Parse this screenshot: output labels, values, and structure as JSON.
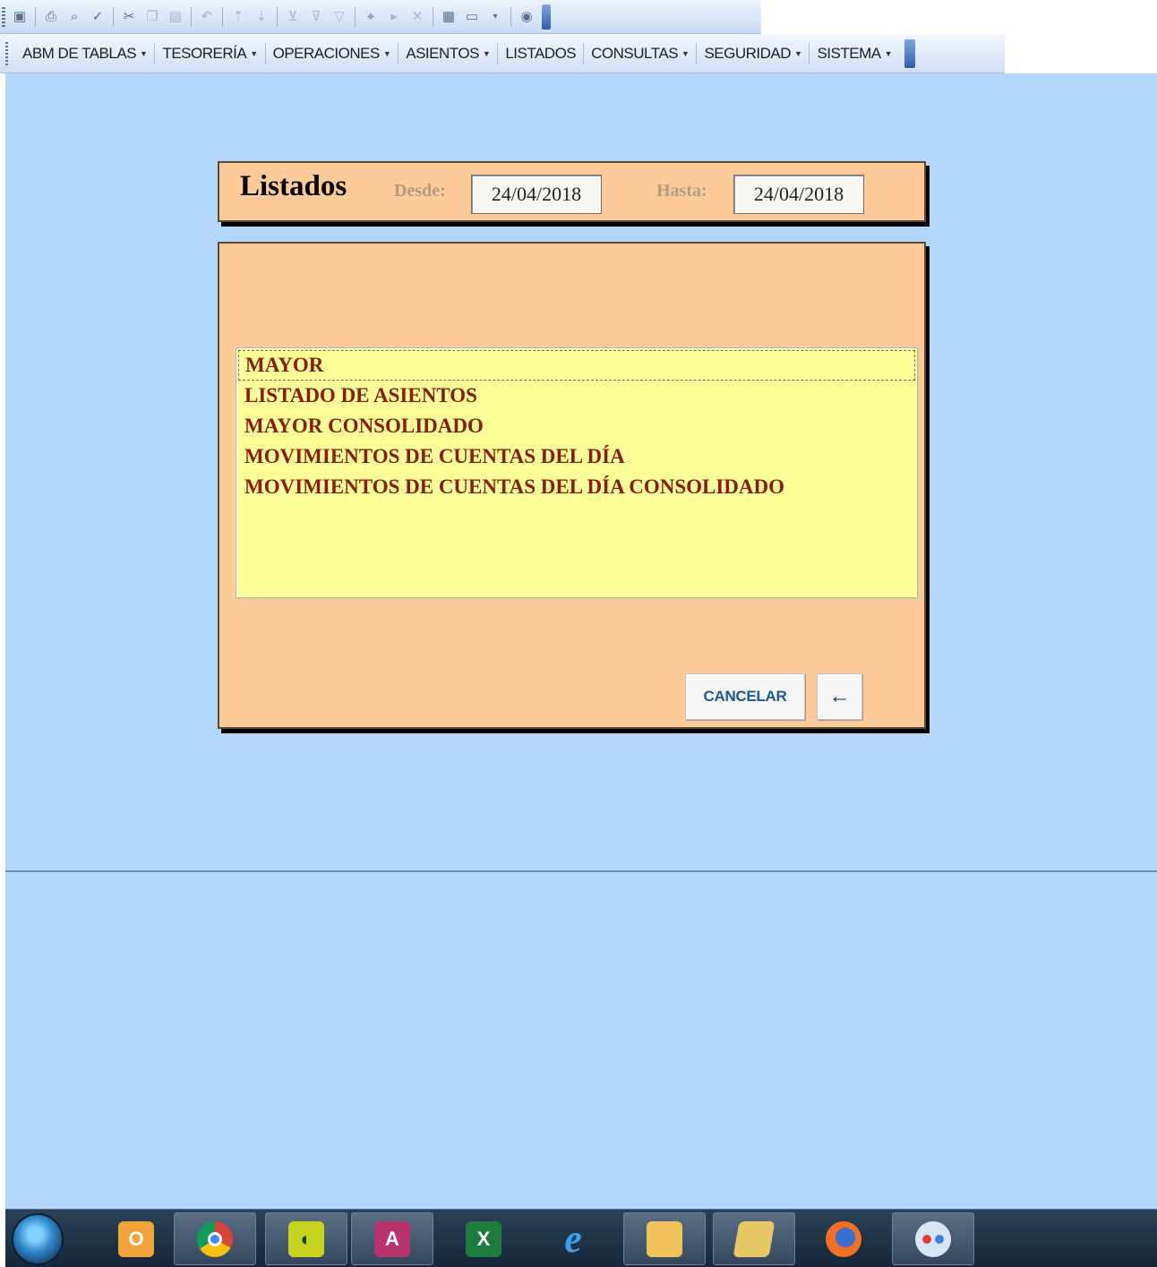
{
  "toolbar": {
    "icons": [
      "save-icon",
      "print-icon",
      "print-preview-icon",
      "spellcheck-icon",
      "cut-icon",
      "copy-icon",
      "paste-icon",
      "undo-icon",
      "sort-ascending-icon",
      "sort-descending-icon",
      "filter-selection-icon",
      "filter-form-icon",
      "apply-filter-icon",
      "find-icon",
      "new-record-icon",
      "delete-record-icon",
      "database-window-icon",
      "new-object-icon",
      "help-icon"
    ]
  },
  "menubar": {
    "items": [
      {
        "label": "ABM DE TABLAS",
        "has_dropdown": true
      },
      {
        "label": "TESORERÍA",
        "has_dropdown": true
      },
      {
        "label": "OPERACIONES",
        "has_dropdown": true
      },
      {
        "label": "ASIENTOS",
        "has_dropdown": true
      },
      {
        "label": "LISTADOS",
        "has_dropdown": false
      },
      {
        "label": "CONSULTAS",
        "has_dropdown": true
      },
      {
        "label": "SEGURIDAD",
        "has_dropdown": true
      },
      {
        "label": "SISTEMA",
        "has_dropdown": true
      }
    ]
  },
  "form": {
    "title": "Listados",
    "desde_label": "Desde:",
    "desde_value": "24/04/2018",
    "hasta_label": "Hasta:",
    "hasta_value": "24/04/2018",
    "list_items": [
      "MAYOR",
      "LISTADO DE ASIENTOS",
      "MAYOR CONSOLIDADO",
      "MOVIMIENTOS DE CUENTAS DEL DÍA",
      "MOVIMIENTOS DE CUENTAS DEL DÍA CONSOLIDADO"
    ],
    "selected_index": 0,
    "cancel_label": "CANCELAR",
    "back_glyph": "←"
  },
  "taskbar": {
    "apps": [
      "windows-start-icon",
      "outlook-icon",
      "chrome-icon",
      "custom-app-icon",
      "access-icon",
      "excel-icon",
      "internet-explorer-icon",
      "file-explorer-icon",
      "folder-icon",
      "firefox-icon",
      "paint-icon"
    ]
  },
  "colors": {
    "workspace": "#b3d8fb",
    "panel": "#fccb97",
    "list_background": "#ffff99",
    "list_text": "#8b1a00",
    "button_text": "#1b5a9b"
  }
}
